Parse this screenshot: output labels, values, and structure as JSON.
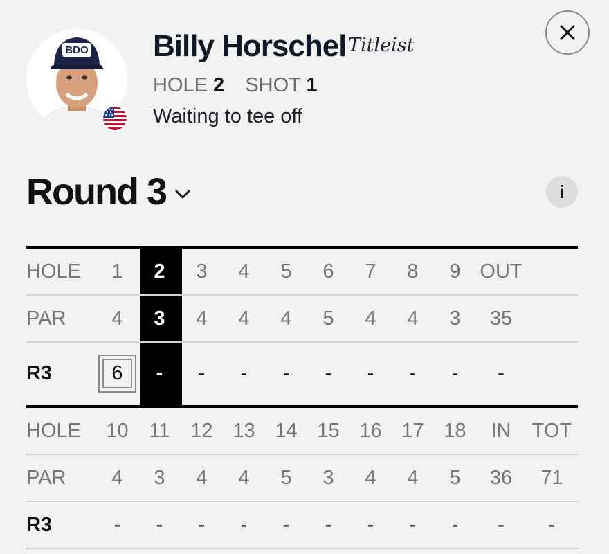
{
  "player": {
    "name": "Billy Horschel",
    "brand": "Titleist",
    "hole_label": "HOLE",
    "hole_value": "2",
    "shot_label": "SHOT",
    "shot_value": "1",
    "status": "Waiting to tee off",
    "cap_text": "BDO"
  },
  "close_icon": "close-icon",
  "round": {
    "title": "Round 3",
    "info_label": "i"
  },
  "front_nine": {
    "hole_label": "HOLE",
    "holes": [
      "1",
      "2",
      "3",
      "4",
      "5",
      "6",
      "7",
      "8",
      "9",
      "OUT"
    ],
    "par_label": "PAR",
    "pars": [
      "4",
      "3",
      "4",
      "4",
      "4",
      "5",
      "4",
      "4",
      "3",
      "35"
    ],
    "round_label": "R3",
    "scores": [
      "6",
      "-",
      "-",
      "-",
      "-",
      "-",
      "-",
      "-",
      "-",
      "-"
    ]
  },
  "back_nine": {
    "hole_label": "HOLE",
    "holes": [
      "10",
      "11",
      "12",
      "13",
      "14",
      "15",
      "16",
      "17",
      "18",
      "IN",
      "TOT"
    ],
    "par_label": "PAR",
    "pars": [
      "4",
      "3",
      "4",
      "4",
      "5",
      "3",
      "4",
      "4",
      "5",
      "36",
      "71"
    ],
    "round_label": "R3",
    "scores": [
      "-",
      "-",
      "-",
      "-",
      "-",
      "-",
      "-",
      "-",
      "-",
      "-",
      "-"
    ]
  },
  "colors": {
    "background": "#f2f2f2",
    "current_hole": "#000000",
    "muted_text": "#767676",
    "flag_red": "#c8102e",
    "flag_blue": "#1f3d8a"
  }
}
